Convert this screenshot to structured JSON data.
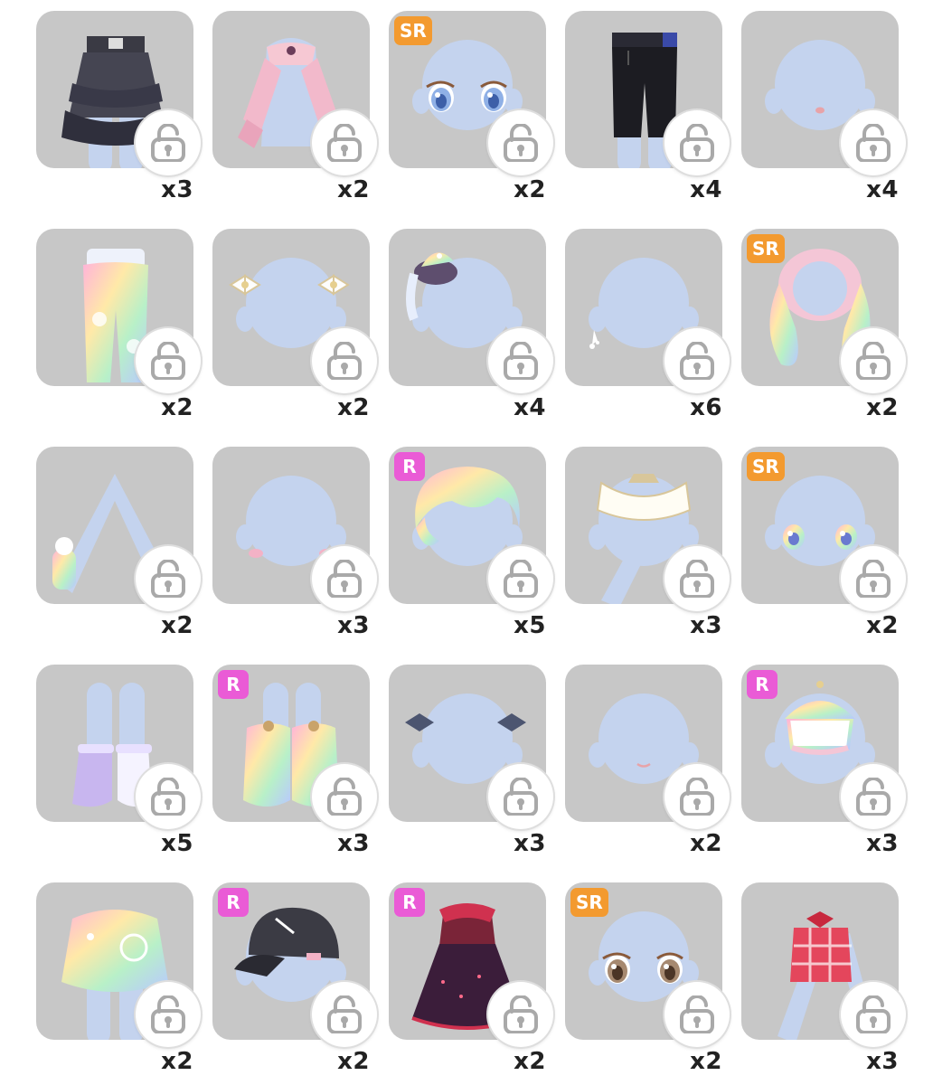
{
  "colors": {
    "tile_bg": "#c7c7c7",
    "badge_sr": "#f39a2f",
    "badge_r": "#ea5bd6",
    "mannequin": "#c4d3ee",
    "lock_icon": "#a9a9a9"
  },
  "items": [
    {
      "name": "black-ruffle-skirt",
      "art": "skirt_black",
      "rarity": "",
      "count": "x3"
    },
    {
      "name": "pink-ribbon-sleeves",
      "art": "sleeves_pink",
      "rarity": "",
      "count": "x2"
    },
    {
      "name": "blue-eyes",
      "art": "eyes_blue",
      "rarity": "SR",
      "count": "x2"
    },
    {
      "name": "black-pants",
      "art": "pants_black",
      "rarity": "",
      "count": "x4"
    },
    {
      "name": "small-mouth",
      "art": "mouth",
      "rarity": "",
      "count": "x4"
    },
    {
      "name": "rainbow-cloud-pants",
      "art": "pants_rainbow",
      "rarity": "",
      "count": "x2"
    },
    {
      "name": "white-bow-clips",
      "art": "bows_white",
      "rarity": "",
      "count": "x2"
    },
    {
      "name": "pastel-mini-hat",
      "art": "hat_pastel",
      "rarity": "",
      "count": "x4"
    },
    {
      "name": "star-earring",
      "art": "earring",
      "rarity": "",
      "count": "x6"
    },
    {
      "name": "pink-pastel-twintail-hair",
      "art": "hair_pink",
      "rarity": "SR",
      "count": "x2"
    },
    {
      "name": "rainbow-cuffs",
      "art": "cuffs",
      "rarity": "",
      "count": "x2"
    },
    {
      "name": "cheek-blush",
      "art": "blush",
      "rarity": "",
      "count": "x3"
    },
    {
      "name": "rainbow-short-hair",
      "art": "hair_rainbow",
      "rarity": "R",
      "count": "x5"
    },
    {
      "name": "white-collar-cape",
      "art": "collar",
      "rarity": "",
      "count": "x3"
    },
    {
      "name": "rainbow-galaxy-eyes",
      "art": "eyes_rainbow",
      "rarity": "SR",
      "count": "x2"
    },
    {
      "name": "lilac-boots",
      "art": "boots_lilac",
      "rarity": "",
      "count": "x5"
    },
    {
      "name": "pastel-ruffle-socks",
      "art": "socks",
      "rarity": "R",
      "count": "x3"
    },
    {
      "name": "dark-bow-clips",
      "art": "bows_dark",
      "rarity": "",
      "count": "x3"
    },
    {
      "name": "smile-mouth",
      "art": "mouth_smile",
      "rarity": "",
      "count": "x2"
    },
    {
      "name": "carousel-hat",
      "art": "carousel",
      "rarity": "R",
      "count": "x3"
    },
    {
      "name": "carnival-pastel-skirt",
      "art": "skirt_pastel",
      "rarity": "",
      "count": "x2"
    },
    {
      "name": "black-cap",
      "art": "cap",
      "rarity": "R",
      "count": "x2"
    },
    {
      "name": "red-polka-dress",
      "art": "dress",
      "rarity": "R",
      "count": "x2"
    },
    {
      "name": "brown-eyes",
      "art": "eyes_brown",
      "rarity": "SR",
      "count": "x2"
    },
    {
      "name": "red-plaid-top",
      "art": "top_plaid",
      "rarity": "",
      "count": "x3"
    }
  ]
}
